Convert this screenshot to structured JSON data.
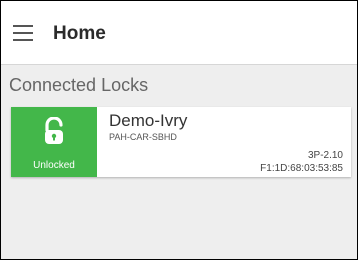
{
  "app_bar": {
    "title": "Home",
    "menu_icon": "menu-icon"
  },
  "section": {
    "title": "Connected Locks"
  },
  "locks": [
    {
      "name": "Demo-Ivry",
      "serial": "PAH-CAR-SBHD",
      "version": "3P-2.10",
      "mac": "F1:1D:68:03:53:85",
      "status": "Unlocked",
      "status_icon": "unlocked-padlock-icon",
      "status_color": "#43b74a"
    }
  ],
  "colors": {
    "app_bar_background": "#ffffff",
    "screen_background": "#eeeeee",
    "unlocked_green": "#43b74a"
  }
}
